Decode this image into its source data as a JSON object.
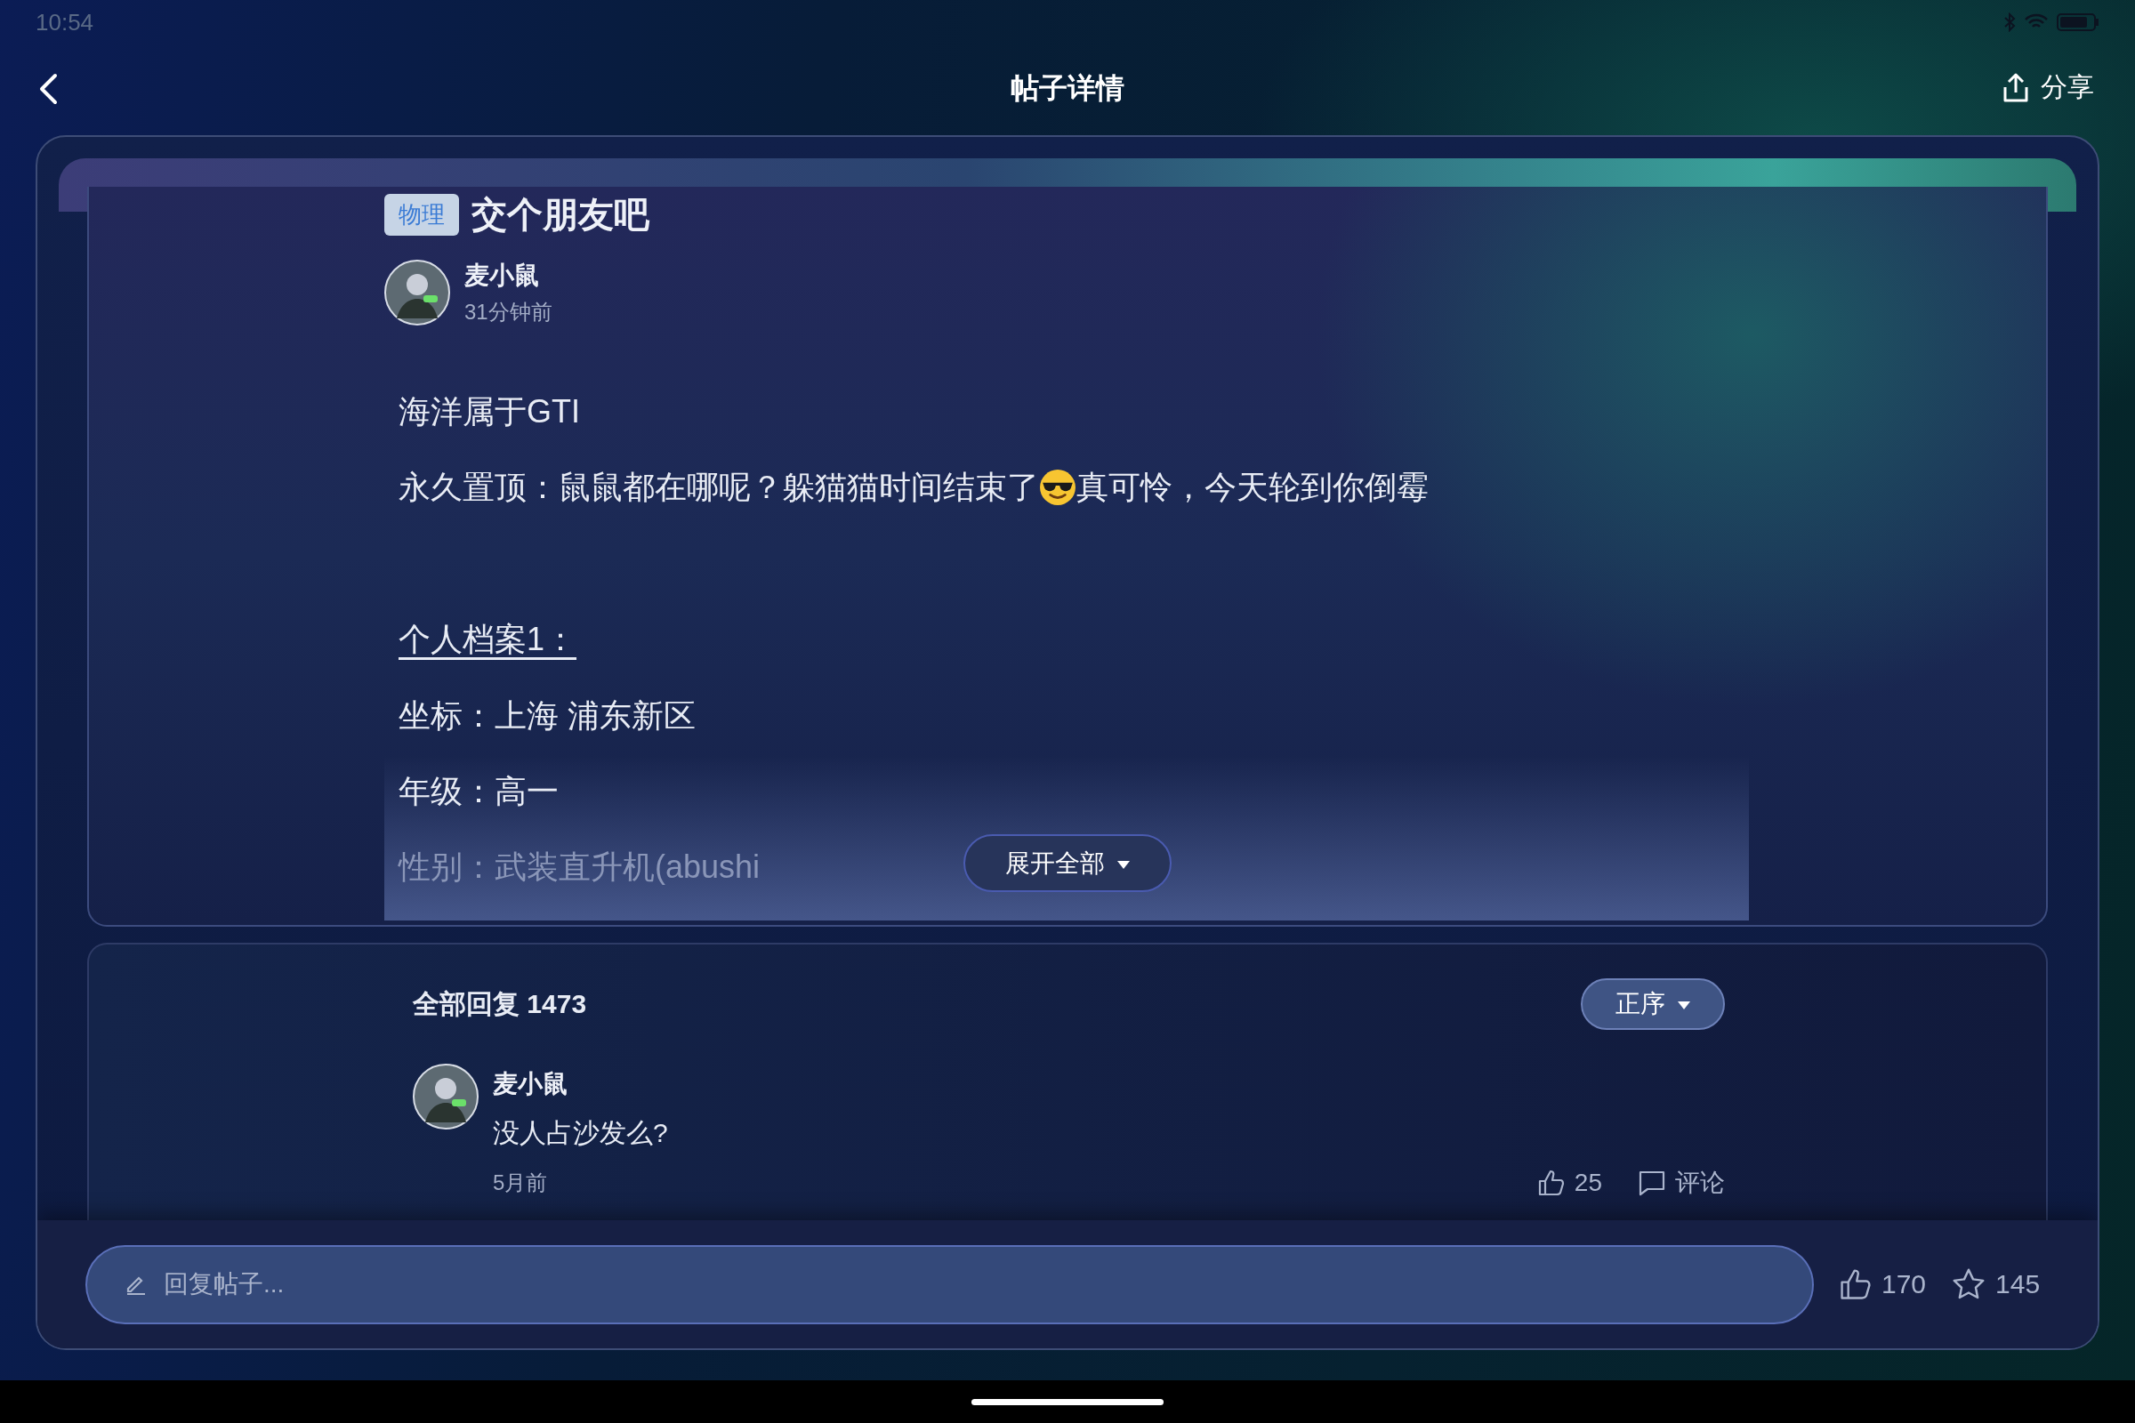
{
  "status_bar": {
    "time": "10:54"
  },
  "header": {
    "title": "帖子详情",
    "share": "分享"
  },
  "post": {
    "tag": "物理",
    "title": "交个朋友吧",
    "author": {
      "name": "麦小鼠",
      "time": "31分钟前"
    },
    "paragraphs": [
      {
        "kind": "text",
        "text": "海洋属于GTI",
        "faded": false
      },
      {
        "kind": "emoji",
        "before": "永久置顶：鼠鼠都在哪呢？躲猫猫时间结束了",
        "after": "真可怜，今天轮到你倒霉",
        "faded": false
      },
      {
        "kind": "heading",
        "text": "个人档案1：",
        "faded": false
      },
      {
        "kind": "text",
        "text": "坐标：上海   浦东新区",
        "faded": false
      },
      {
        "kind": "text",
        "text": "年级：高一",
        "faded": false
      },
      {
        "kind": "text",
        "text": "性别：武装直升机(abushi",
        "faded": true
      }
    ],
    "expand_button": "展开全部"
  },
  "replies": {
    "title": "全部回复 1473",
    "sort_button": "正序",
    "comments": [
      {
        "name": "麦小鼠",
        "text": "没人占沙发么?",
        "time": "5月前",
        "likes": "25",
        "comment_action": "评论"
      }
    ]
  },
  "bottom_bar": {
    "placeholder": "回复帖子...",
    "likes": "170",
    "favorites": "145"
  }
}
